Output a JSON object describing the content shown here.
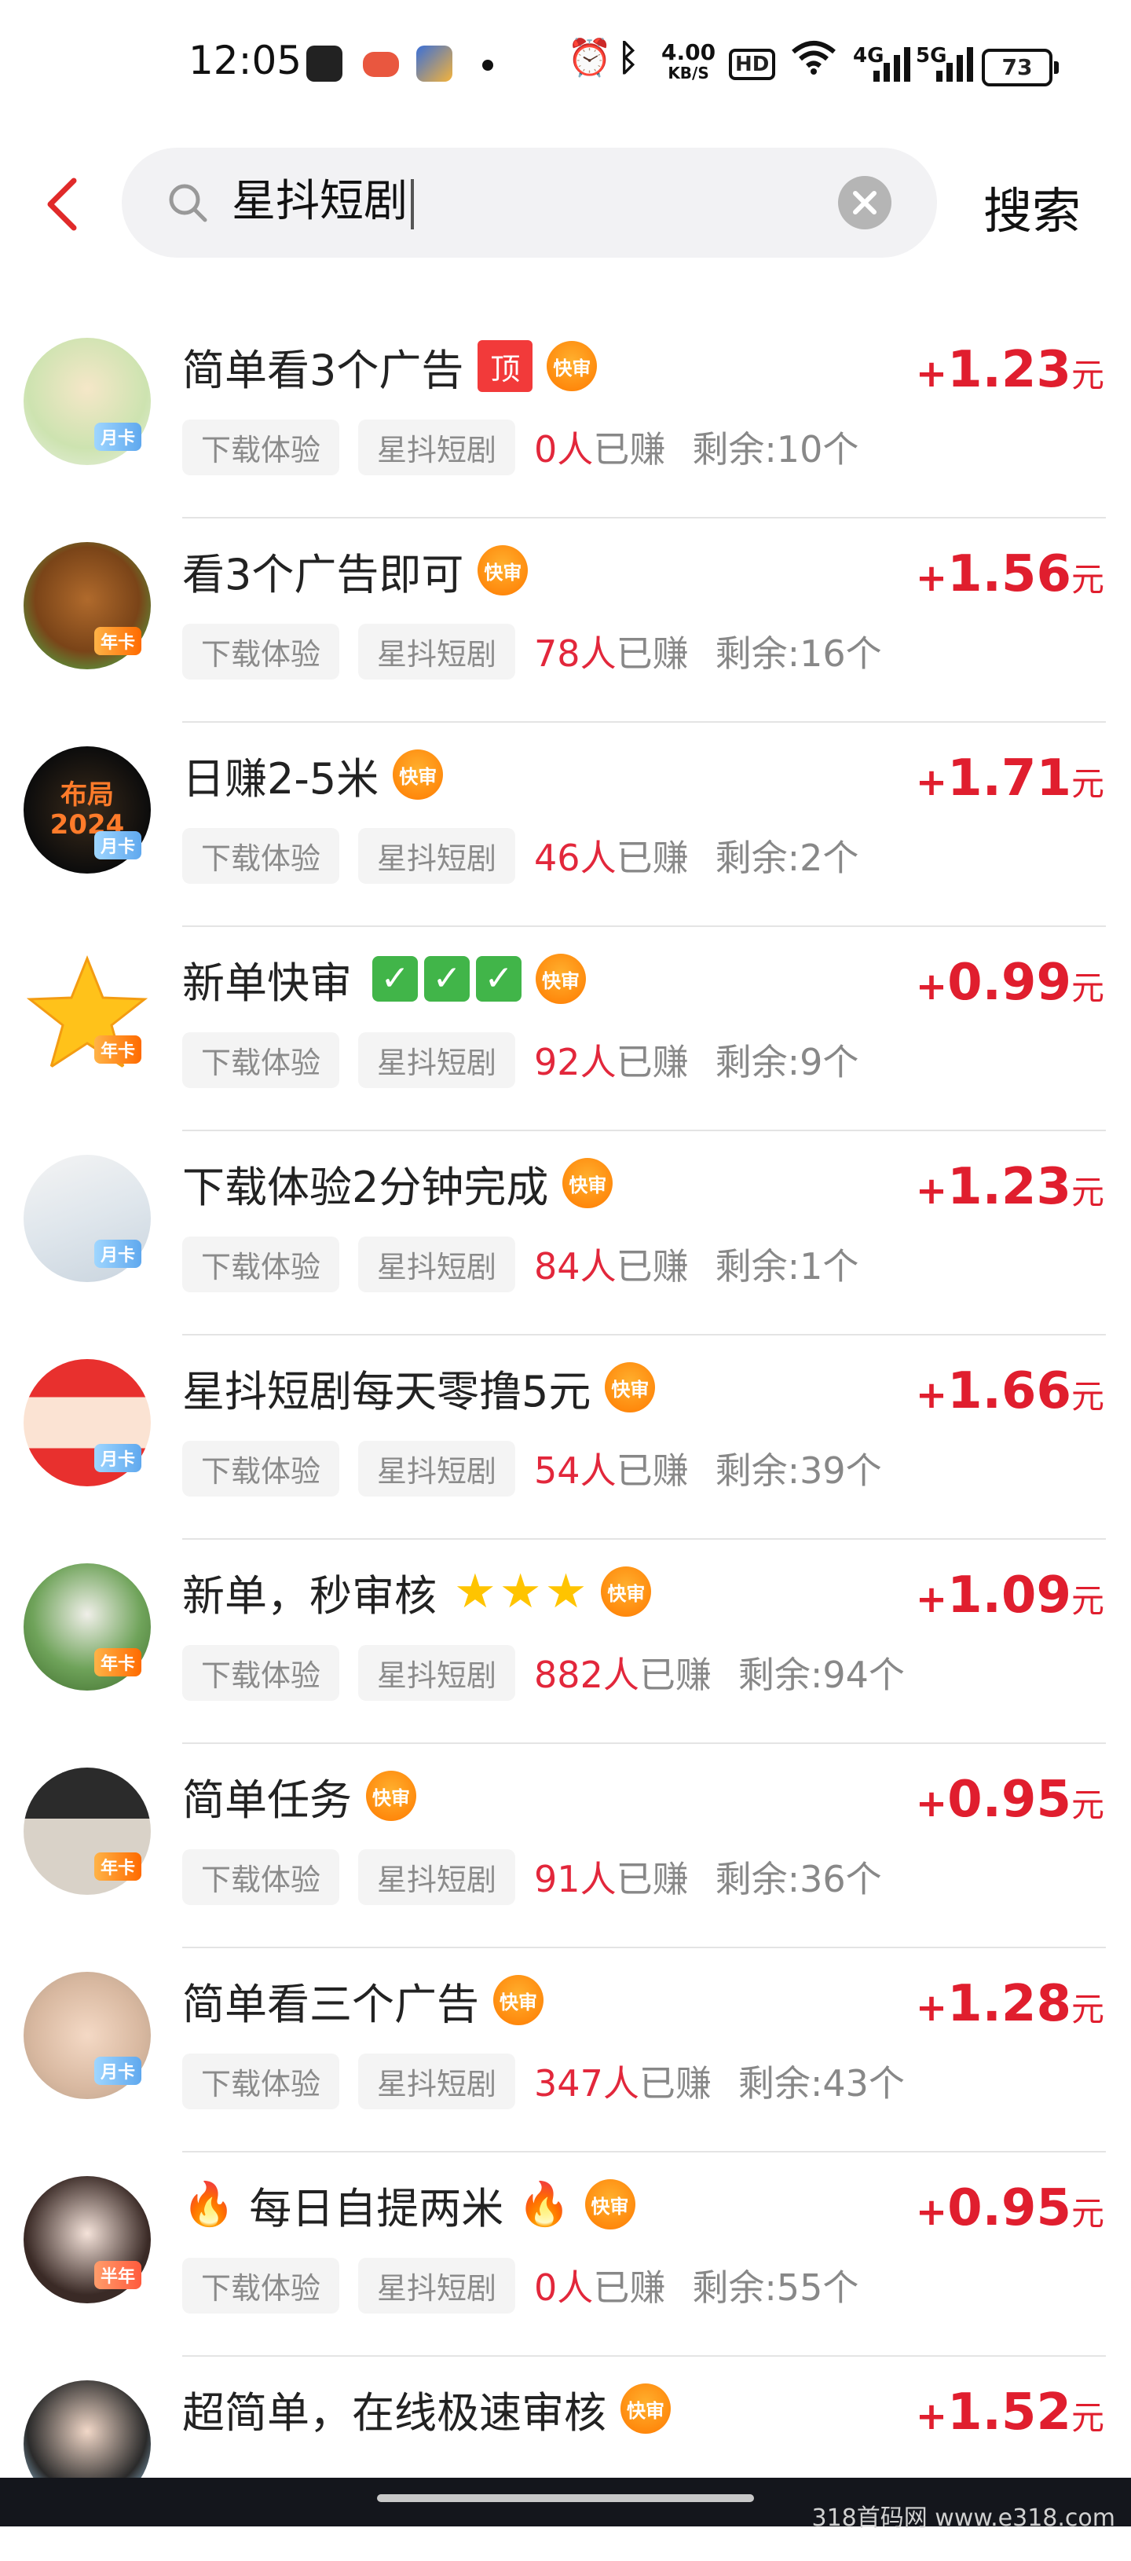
{
  "status_bar": {
    "time": "12:05",
    "net_speed_value": "4.00",
    "net_speed_unit": "KB/S",
    "hd_label": "HD",
    "net_4g": "4G",
    "net_5g": "5G",
    "battery": "73"
  },
  "search": {
    "query": "星抖短剧",
    "button_label": "搜索"
  },
  "colors": {
    "accent_red": "#e01e2e",
    "fast_badge": "#ff8a00"
  },
  "list": [
    {
      "title": "简单看3个广告",
      "top_tag": "顶",
      "fast_tag": "快审",
      "tag1": "下载体验",
      "tag2": "星抖短剧",
      "earned_num": "0人",
      "earned_text": "已赚",
      "remain": "剩余:10个",
      "price_plus": "+",
      "price": "1.23",
      "unit": "元",
      "vip": "月卡"
    },
    {
      "title": "看3个广告即可",
      "fast_tag": "快审",
      "tag1": "下载体验",
      "tag2": "星抖短剧",
      "earned_num": "78人",
      "earned_text": "已赚",
      "remain": "剩余:16个",
      "price_plus": "+",
      "price": "1.56",
      "unit": "元",
      "vip": "年卡"
    },
    {
      "title": "日赚2-5米",
      "fast_tag": "快审",
      "tag1": "下载体验",
      "tag2": "星抖短剧",
      "earned_num": "46人",
      "earned_text": "已赚",
      "remain": "剩余:2个",
      "price_plus": "+",
      "price": "1.71",
      "unit": "元",
      "vip": "月卡",
      "avatar_text": "布局 2024"
    },
    {
      "title": "新单快审",
      "fast_tag": "快审",
      "tag1": "下载体验",
      "tag2": "星抖短剧",
      "earned_num": "92人",
      "earned_text": "已赚",
      "remain": "剩余:9个",
      "price_plus": "+",
      "price": "0.99",
      "unit": "元",
      "vip": "年卡"
    },
    {
      "title": "下载体验2分钟完成",
      "fast_tag": "快审",
      "tag1": "下载体验",
      "tag2": "星抖短剧",
      "earned_num": "84人",
      "earned_text": "已赚",
      "remain": "剩余:1个",
      "price_plus": "+",
      "price": "1.23",
      "unit": "元",
      "vip": "月卡"
    },
    {
      "title": "星抖短剧每天零撸5元",
      "fast_tag": "快审",
      "tag1": "下载体验",
      "tag2": "星抖短剧",
      "earned_num": "54人",
      "earned_text": "已赚",
      "remain": "剩余:39个",
      "price_plus": "+",
      "price": "1.66",
      "unit": "元",
      "vip": "月卡"
    },
    {
      "title": "新单，秒审核",
      "fast_tag": "快审",
      "tag1": "下载体验",
      "tag2": "星抖短剧",
      "earned_num": "882人",
      "earned_text": "已赚",
      "remain": "剩余:94个",
      "price_plus": "+",
      "price": "1.09",
      "unit": "元",
      "vip": "年卡"
    },
    {
      "title": "简单任务",
      "fast_tag": "快审",
      "tag1": "下载体验",
      "tag2": "星抖短剧",
      "earned_num": "91人",
      "earned_text": "已赚",
      "remain": "剩余:36个",
      "price_plus": "+",
      "price": "0.95",
      "unit": "元",
      "vip": "年卡"
    },
    {
      "title": "简单看三个广告",
      "fast_tag": "快审",
      "tag1": "下载体验",
      "tag2": "星抖短剧",
      "earned_num": "347人",
      "earned_text": "已赚",
      "remain": "剩余:43个",
      "price_plus": "+",
      "price": "1.28",
      "unit": "元",
      "vip": "月卡"
    },
    {
      "title": "每日自提两米",
      "fast_tag": "快审",
      "tag1": "下载体验",
      "tag2": "星抖短剧",
      "earned_num": "0人",
      "earned_text": "已赚",
      "remain": "剩余:55个",
      "price_plus": "+",
      "price": "0.95",
      "unit": "元",
      "vip": "半年"
    },
    {
      "title": "超简单，在线极速审核",
      "fast_tag": "快审",
      "price_plus": "+",
      "price": "1.52",
      "unit": "元"
    }
  ],
  "watermark": "318首码网 www.e318.com"
}
